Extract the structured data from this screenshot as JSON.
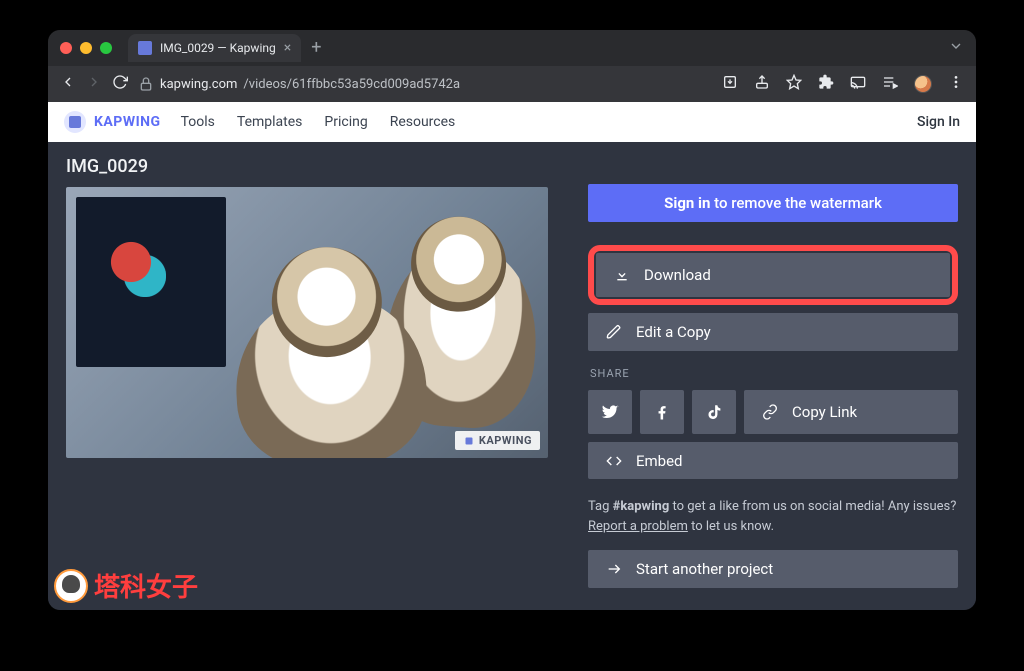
{
  "browser": {
    "tab_title": "IMG_0029 — Kapwing",
    "url_host": "kapwing.com",
    "url_path": "/videos/61ffbbc53a59cd009ad5742a"
  },
  "app": {
    "brand": "KAPWING",
    "nav": {
      "tools": "Tools",
      "templates": "Templates",
      "pricing": "Pricing",
      "resources": "Resources"
    },
    "signin": "Sign In"
  },
  "project": {
    "title": "IMG_0029",
    "watermark": "KAPWING"
  },
  "cta": {
    "signin_bold": "Sign in",
    "signin_rest": " to remove the watermark"
  },
  "actions": {
    "download": "Download",
    "edit_copy": "Edit a Copy",
    "copy_link": "Copy Link",
    "embed": "Embed",
    "start_another": "Start another project"
  },
  "share": {
    "label": "SHARE"
  },
  "footer": {
    "prefix": "Tag ",
    "hashtag": "#kapwing",
    "mid": " to get a like from us on social media! Any issues? ",
    "link": "Report a problem",
    "suffix": " to let us know."
  },
  "corner_brand": "塔科女子"
}
